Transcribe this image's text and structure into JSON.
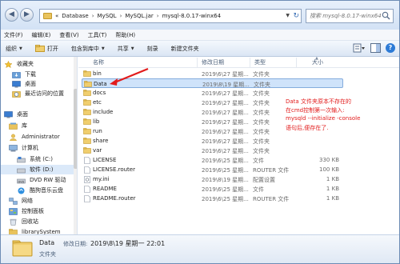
{
  "address": {
    "back_icon": "back-arrow-icon",
    "forward_icon": "forward-arrow-icon",
    "prefix": "«",
    "crumbs": [
      "Database",
      "MySQL",
      "MySQL.jar",
      "mysql-8.0.17-winx64"
    ],
    "separator": "›",
    "search_placeholder": "搜索 mysql-8.0.17-winx64"
  },
  "menu": [
    "文件(F)",
    "编辑(E)",
    "查看(V)",
    "工具(T)",
    "帮助(H)"
  ],
  "toolbar": {
    "organize": "组织",
    "open": "打开",
    "include_in_library": "包含到库中",
    "share": "共享",
    "burn": "刻录",
    "new_folder": "新建文件夹"
  },
  "nav": {
    "items": [
      {
        "label": "收藏夹",
        "icon": "star-icon"
      },
      {
        "label": "下载",
        "icon": "download-folder-icon"
      },
      {
        "label": "桌面",
        "icon": "desktop-icon"
      },
      {
        "label": "最近访问的位置",
        "icon": "recent-places-icon"
      },
      {
        "label": "桌面",
        "icon": "desktop-icon"
      },
      {
        "label": "库",
        "icon": "library-icon"
      },
      {
        "label": "Administrator",
        "icon": "user-icon"
      },
      {
        "label": "计算机",
        "icon": "computer-icon"
      },
      {
        "label": "系统 (C:)",
        "icon": "drive-icon"
      },
      {
        "label": "软件 (D:)",
        "icon": "drive-icon"
      },
      {
        "label": "DVD RW 驱动",
        "icon": "dvd-drive-icon"
      },
      {
        "label": "酷狗音乐云盘",
        "icon": "cloud-drive-icon"
      },
      {
        "label": "网络",
        "icon": "network-icon"
      },
      {
        "label": "控制面板",
        "icon": "control-panel-icon"
      },
      {
        "label": "回收站",
        "icon": "recycle-bin-icon"
      },
      {
        "label": "librarySystem",
        "icon": "folder-icon"
      }
    ],
    "selected_index": 9
  },
  "columns": {
    "name": "名称",
    "date": "修改日期",
    "type": "类型",
    "size": "大小"
  },
  "files": [
    {
      "name": "bin",
      "date": "2019\\6\\27 星期...",
      "type": "文件夹",
      "size": "",
      "kind": "folder"
    },
    {
      "name": "Data",
      "date": "2019\\8\\19 星期...",
      "type": "文件夹",
      "size": "",
      "kind": "folder",
      "selected": true
    },
    {
      "name": "docs",
      "date": "2019\\6\\27 星期...",
      "type": "文件夹",
      "size": "",
      "kind": "folder"
    },
    {
      "name": "etc",
      "date": "2019\\6\\27 星期...",
      "type": "文件夹",
      "size": "",
      "kind": "folder"
    },
    {
      "name": "include",
      "date": "2019\\6\\27 星期...",
      "type": "文件夹",
      "size": "",
      "kind": "folder"
    },
    {
      "name": "lib",
      "date": "2019\\6\\27 星期...",
      "type": "文件夹",
      "size": "",
      "kind": "folder"
    },
    {
      "name": "run",
      "date": "2019\\6\\27 星期...",
      "type": "文件夹",
      "size": "",
      "kind": "folder"
    },
    {
      "name": "share",
      "date": "2019\\6\\27 星期...",
      "type": "文件夹",
      "size": "",
      "kind": "folder"
    },
    {
      "name": "var",
      "date": "2019\\6\\27 星期...",
      "type": "文件夹",
      "size": "",
      "kind": "folder"
    },
    {
      "name": "LICENSE",
      "date": "2019\\6\\25 星期...",
      "type": "文件",
      "size": "330 KB",
      "kind": "file"
    },
    {
      "name": "LICENSE.router",
      "date": "2019\\6\\25 星期...",
      "type": "ROUTER 文件",
      "size": "100 KB",
      "kind": "file"
    },
    {
      "name": "my.ini",
      "date": "2019\\8\\19 星期...",
      "type": "配置设置",
      "size": "1 KB",
      "kind": "ini"
    },
    {
      "name": "README",
      "date": "2019\\6\\25 星期...",
      "type": "文件",
      "size": "1 KB",
      "kind": "file"
    },
    {
      "name": "README.router",
      "date": "2019\\6\\25 星期...",
      "type": "ROUTER 文件",
      "size": "1 KB",
      "kind": "file"
    }
  ],
  "annotation": {
    "line1": "Data 文件夹原本不存在的",
    "line2": "在cmd控制第一次输入:",
    "line3": "mysqld --initialize -console",
    "line4": "语句后,便存在了.",
    "color": "#e21b1b"
  },
  "details": {
    "name": "Data",
    "date_label": "修改日期:",
    "date": "2019\\8\\19 星期一 22:01",
    "type": "文件夹"
  }
}
